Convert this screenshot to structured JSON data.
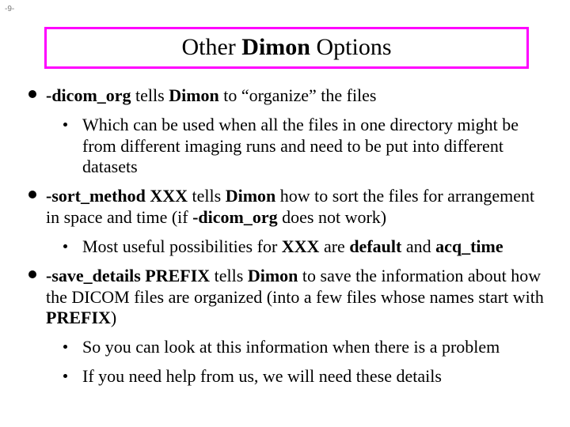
{
  "page_number": "-9-",
  "title": {
    "pre": "Other ",
    "bold": "Dimon",
    "post": " Options"
  },
  "bullets": [
    {
      "segments": [
        {
          "t": "-dicom_org",
          "b": true
        },
        {
          "t": " tells ",
          "b": false
        },
        {
          "t": "Dimon",
          "b": true
        },
        {
          "t": " to “organize” the files",
          "b": false
        }
      ],
      "sub": [
        {
          "segments": [
            {
              "t": "Which can be used when all the files in one directory might be from different imaging runs and need to be put into different datasets",
              "b": false
            }
          ]
        }
      ]
    },
    {
      "segments": [
        {
          "t": "-sort_method XXX",
          "b": true
        },
        {
          "t": " tells ",
          "b": false
        },
        {
          "t": "Dimon",
          "b": true
        },
        {
          "t": " how to sort the files for arrangement in space and time (if ",
          "b": false
        },
        {
          "t": "-dicom_org",
          "b": true
        },
        {
          "t": " does not work)",
          "b": false
        }
      ],
      "sub": [
        {
          "segments": [
            {
              "t": "Most useful possibilities for ",
              "b": false
            },
            {
              "t": "XXX",
              "b": true
            },
            {
              "t": " are ",
              "b": false
            },
            {
              "t": "default",
              "b": true
            },
            {
              "t": " and ",
              "b": false
            },
            {
              "t": "acq_time",
              "b": true
            }
          ]
        }
      ]
    },
    {
      "segments": [
        {
          "t": "-save_details PREFIX",
          "b": true
        },
        {
          "t": " tells ",
          "b": false
        },
        {
          "t": "Dimon",
          "b": true
        },
        {
          "t": " to save the information about how the DICOM files are organized (into a few files whose names start with ",
          "b": false
        },
        {
          "t": "PREFIX",
          "b": true
        },
        {
          "t": ")",
          "b": false
        }
      ],
      "sub": [
        {
          "segments": [
            {
              "t": "So you can look at this information when there is a problem",
              "b": false
            }
          ]
        },
        {
          "segments": [
            {
              "t": "If you need help from us, we will need these details",
              "b": false
            }
          ]
        }
      ]
    }
  ]
}
